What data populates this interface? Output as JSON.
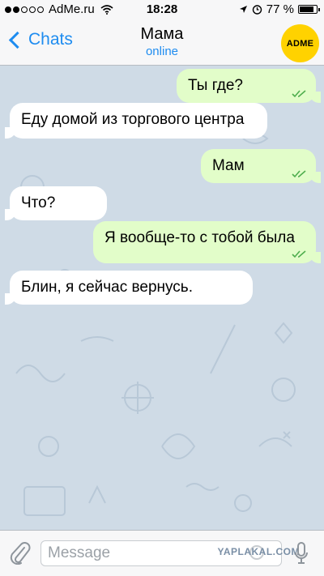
{
  "status_bar": {
    "carrier": "AdMe.ru",
    "time": "18:28",
    "battery": "77 %",
    "battery_level": 0.77
  },
  "header": {
    "back_label": "Chats",
    "title": "Мама",
    "status": "online",
    "avatar_text": "ADME"
  },
  "messages": [
    {
      "direction": "out",
      "text": "Ты где?",
      "read": true
    },
    {
      "direction": "in",
      "text": "Еду домой из торгового центра"
    },
    {
      "direction": "out",
      "text": "Мам",
      "read": true
    },
    {
      "direction": "in",
      "text": "Что?"
    },
    {
      "direction": "out",
      "text": "Я вообще-то с тобой была",
      "read": true
    },
    {
      "direction": "in",
      "text": "Блин, я сейчас вернусь."
    }
  ],
  "input": {
    "placeholder": "Message",
    "value": ""
  },
  "watermark": "YAPLAKAL.COM",
  "colors": {
    "accent": "#1e8cf0",
    "outgoing_bubble": "#e2fdc9",
    "incoming_bubble": "#ffffff",
    "read_check": "#4fae4e",
    "chat_background": "#cfdbe6"
  }
}
